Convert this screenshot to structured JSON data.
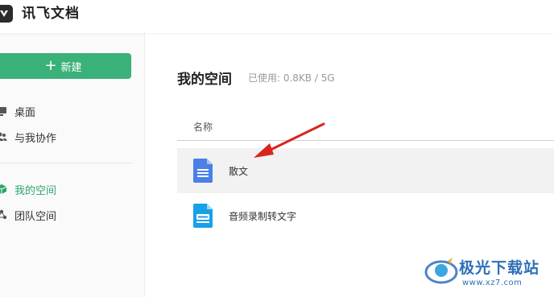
{
  "app": {
    "title": "讯飞文档"
  },
  "sidebar": {
    "new_button": "新建",
    "items": [
      {
        "label": "桌面",
        "icon": "desktop-icon"
      },
      {
        "label": "与我协作",
        "icon": "people-icon"
      },
      {
        "label": "我的空间",
        "icon": "cube-icon",
        "active": true
      },
      {
        "label": "团队空间",
        "icon": "team-icon"
      }
    ]
  },
  "main": {
    "title": "我的空间",
    "usage": "已使用: 0.8KB / 5G",
    "column_header": "名称",
    "files": [
      {
        "name": "散文",
        "icon": "document-icon",
        "selected": true
      },
      {
        "name": "音频录制转文字",
        "icon": "audio-transcript-icon"
      }
    ]
  },
  "watermark": {
    "brand": "极光下载站",
    "url": "www.xz7.com"
  },
  "colors": {
    "accent": "#3bb17a",
    "doc_blue": "#4a80e8",
    "audio_blue": "#1aa0e8",
    "arrow_red": "#d9261c"
  }
}
